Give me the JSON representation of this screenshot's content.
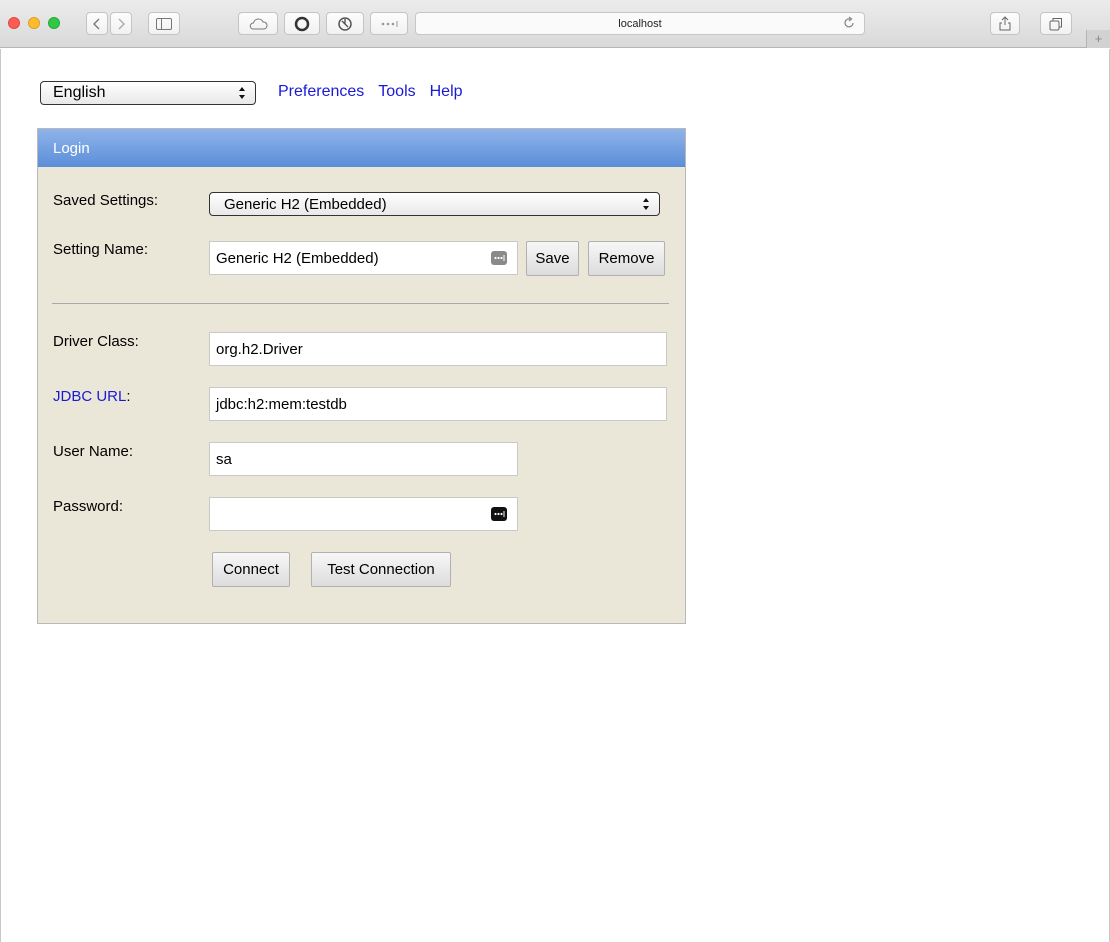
{
  "browser": {
    "address": "localhost",
    "plus_tab": "+"
  },
  "top": {
    "language": "English",
    "links": [
      "Preferences",
      "Tools",
      "Help"
    ]
  },
  "login": {
    "title": "Login",
    "saved_settings_label": "Saved Settings:",
    "saved_settings_value": "Generic H2 (Embedded)",
    "setting_name_label": "Setting Name:",
    "setting_name_value": "Generic H2 (Embedded)",
    "save_label": "Save",
    "remove_label": "Remove",
    "driver_class_label": "Driver Class:",
    "driver_class_value": "org.h2.Driver",
    "jdbc_url_label": "JDBC URL",
    "jdbc_url_colon": ":",
    "jdbc_url_value": "jdbc:h2:mem:testdb",
    "user_name_label": "User Name:",
    "user_name_value": "sa",
    "password_label": "Password:",
    "password_value": "",
    "connect_label": "Connect",
    "test_connection_label": "Test Connection"
  },
  "colors": {
    "panel_bg": "#ebe7d8",
    "header_blue": "#5b8ed8",
    "link_blue": "#1a1ad6"
  }
}
